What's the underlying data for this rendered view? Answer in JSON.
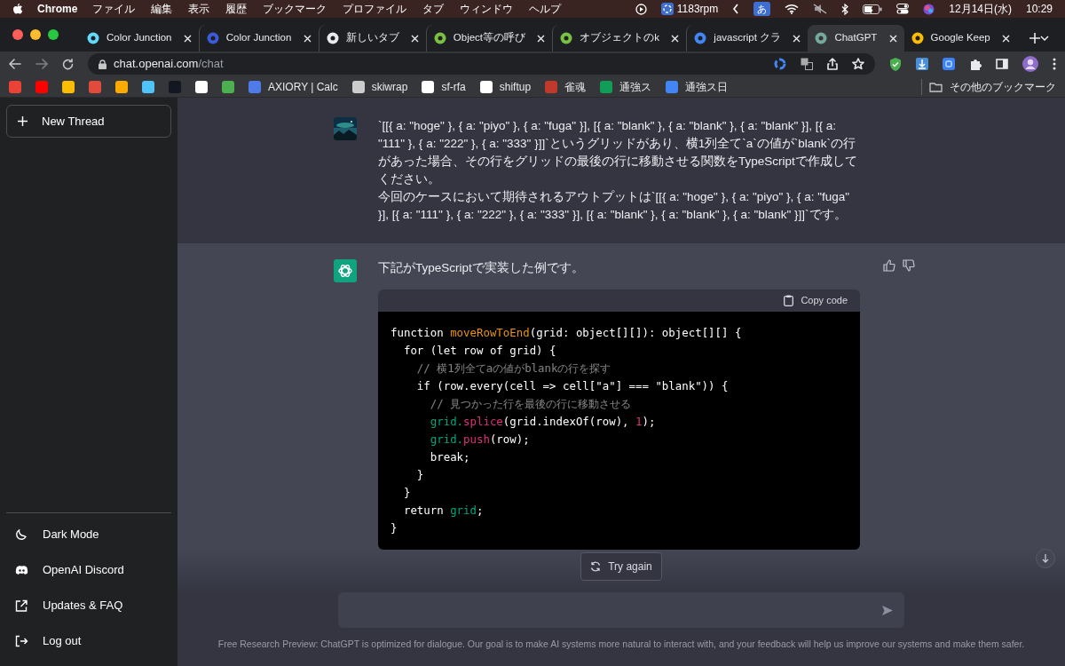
{
  "menubar": {
    "app": "Chrome",
    "menus": [
      "ファイル",
      "編集",
      "表示",
      "履歴",
      "ブックマーク",
      "プロファイル",
      "タブ",
      "ウィンドウ",
      "ヘルプ"
    ],
    "fan_speed": "1183rpm",
    "input_mode": "あ",
    "date": "12月14日(水)",
    "time": "10:29"
  },
  "tabs": [
    {
      "title": "Color Junction",
      "selected": false,
      "color": "#61dafb"
    },
    {
      "title": "Color Junction",
      "selected": false,
      "color": "#3b5bdb"
    },
    {
      "title": "新しいタブ",
      "selected": false,
      "color": "#e8eaed"
    },
    {
      "title": "Object等の呼び",
      "selected": false,
      "color": "#7ac143"
    },
    {
      "title": "オブジェクトのk",
      "selected": false,
      "color": "#7ac143"
    },
    {
      "title": "javascript クラ",
      "selected": false,
      "color": "#4285f4"
    },
    {
      "title": "ChatGPT",
      "selected": true,
      "color": "#74aa9c"
    },
    {
      "title": "Google Keep",
      "selected": false,
      "color": "#fbbc04"
    }
  ],
  "address_bar": {
    "host": "chat.openai.com",
    "path": "/chat"
  },
  "bookmarks": [
    {
      "color": "#ea4335"
    },
    {
      "color": "#ff0000"
    },
    {
      "color": "#fbbc04"
    },
    {
      "color": "#e24a3b"
    },
    {
      "color": "#f9ab00"
    },
    {
      "color": "#4fc3f7"
    },
    {
      "color": "#131722"
    },
    {
      "color": "#ffffff"
    },
    {
      "color": "#4caf50"
    },
    {
      "label": "AXIORY | Calc",
      "color": "#4f7be8"
    },
    {
      "label": "skiwrap",
      "color": "#cccccc"
    },
    {
      "label": "sf-rfa",
      "color": "#ffffff"
    },
    {
      "label": "shiftup",
      "color": "#ffffff"
    },
    {
      "label": "雀魂",
      "color": "#c0392b"
    },
    {
      "label": "通強ス",
      "color": "#0f9d58"
    },
    {
      "label": "通強ス日",
      "color": "#4285f4"
    }
  ],
  "other_bookmarks": "その他のブックマーク",
  "sidebar": {
    "new_thread": "New Thread",
    "items": [
      {
        "label": "Dark Mode",
        "kind": "theme"
      },
      {
        "label": "OpenAI Discord",
        "kind": "discord"
      },
      {
        "label": "Updates & FAQ",
        "kind": "external"
      },
      {
        "label": "Log out",
        "kind": "logout"
      }
    ]
  },
  "conversation": [
    {
      "kind": "user",
      "paragraphs": [
        "`[[{ a: \"hoge\" }, { a: \"piyo\" }, { a: \"fuga\" }], [{ a: \"blank\" }, { a: \"blank\" }, { a: \"blank\" }], [{ a: \"111\" }, { a: \"222\" }, { a: \"333\" }]]`というグリッドがあり、横1列全て`a`の値が`blank`の行があった場合、その行をグリッドの最後の行に移動させる関数をTypeScriptで作成してください。",
        "今回のケースにおいて期待されるアウトプットは`[[{ a: \"hoge\" }, { a: \"piyo\" }, { a: \"fuga\" }], [{ a: \"111\" }, { a: \"222\" }, { a: \"333\" }], [{ a: \"blank\" }, { a: \"blank\" }, { a: \"blank\" }]]`です。"
      ]
    },
    {
      "kind": "assistant",
      "paragraphs": [
        "下記がTypeScriptで実装した例です。"
      ],
      "code": {
        "copy_label": "Copy code",
        "lines": [
          [
            {
              "text": "function ",
              "kind": "plain"
            },
            {
              "text": "moveRowToEnd",
              "kind": "title"
            },
            {
              "text": "(grid: object[][]): object[][] {",
              "kind": "plain"
            }
          ],
          [
            {
              "text": "  for (let row of grid) {",
              "kind": "plain"
            }
          ],
          [
            {
              "text": "    // 横1列全てaの値がblankの行を探す",
              "kind": "comment"
            }
          ],
          [
            {
              "text": "    if (row.every(cell => cell[\"a\"] === \"blank\")) {",
              "kind": "plain"
            }
          ],
          [
            {
              "text": "      // 見つかった行を最後の行に移動させる",
              "kind": "comment"
            }
          ],
          [
            {
              "text": "      grid.",
              "kind": "variable"
            },
            {
              "text": "splice",
              "kind": "call"
            },
            {
              "text": "(grid.indexOf(row), ",
              "kind": "plain"
            },
            {
              "text": "1",
              "kind": "number"
            },
            {
              "text": ");",
              "kind": "plain"
            }
          ],
          [
            {
              "text": "      grid.",
              "kind": "variable"
            },
            {
              "text": "push",
              "kind": "call"
            },
            {
              "text": "(row);",
              "kind": "plain"
            }
          ],
          [
            {
              "text": "      break;",
              "kind": "plain"
            }
          ],
          [
            {
              "text": "    }",
              "kind": "plain"
            }
          ],
          [
            {
              "text": "  }",
              "kind": "plain"
            }
          ],
          [
            {
              "text": "  return ",
              "kind": "plain"
            },
            {
              "text": "grid",
              "kind": "variable"
            },
            {
              "text": ";",
              "kind": "plain"
            }
          ],
          [
            {
              "text": "}",
              "kind": "plain"
            }
          ]
        ]
      }
    }
  ],
  "try_again": "Try again",
  "footer": "Free Research Preview: ChatGPT is optimized for dialogue. Our goal is to make AI systems more natural to interact with, and your feedback will help us improve our systems and make them safer."
}
